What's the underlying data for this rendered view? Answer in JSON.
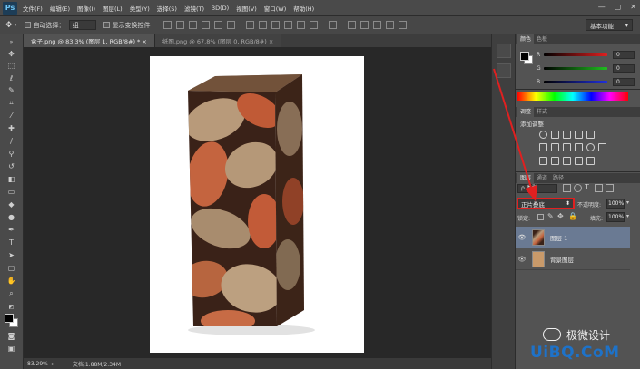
{
  "app": {
    "logo": "Ps",
    "menu": [
      "文件(F)",
      "编辑(E)",
      "图像(I)",
      "图层(L)",
      "类型(Y)",
      "选择(S)",
      "滤镜(T)",
      "3D(D)",
      "视图(V)",
      "窗口(W)",
      "帮助(H)"
    ],
    "window_controls": [
      "—",
      "▢",
      "✕"
    ]
  },
  "options": {
    "auto_select_label": "自动选择：",
    "auto_select_value": "组",
    "show_transform_label": "显示变换控件",
    "workspace": "基本功能"
  },
  "documents": {
    "tabs": [
      {
        "label": "盒子.png @ 83.3% (图层 1, RGB/8#) * ×",
        "active": true
      },
      {
        "label": "纸图.png @ 67.8% (图层 0, RGB/8#) ×",
        "active": false
      }
    ]
  },
  "status": {
    "zoom": "83.29%",
    "doc_info": "文档:1.88M/2.34M"
  },
  "color_panel": {
    "tabs": [
      "颜色",
      "色板"
    ],
    "channels": [
      {
        "label": "R",
        "value": "0",
        "gradient": "linear-gradient(90deg,#000,#e02020)"
      },
      {
        "label": "G",
        "value": "0",
        "gradient": "linear-gradient(90deg,#000,#20c020)"
      },
      {
        "label": "B",
        "value": "0",
        "gradient": "linear-gradient(90deg,#000,#2030e0)"
      }
    ]
  },
  "adjust_panel": {
    "tabs": [
      "调整",
      "样式"
    ],
    "title": "添加调整"
  },
  "layers_panel": {
    "tabs": [
      "图层",
      "通道",
      "路径"
    ],
    "filter_label": "ρ 类型",
    "blend_mode": "正片叠底",
    "opacity_label": "不透明度:",
    "opacity_value": "100%",
    "lock_label": "锁定:",
    "fill_label": "填充:",
    "fill_value": "100%",
    "layers": [
      {
        "name": "图层 1",
        "selected": true
      },
      {
        "name": "背景图层",
        "selected": false
      }
    ]
  },
  "watermark": {
    "brand": "极微设计",
    "site": "UiBQ.CoM"
  },
  "colors": {
    "highlight": "#e02020",
    "selected_layer": "#6a7a93"
  }
}
